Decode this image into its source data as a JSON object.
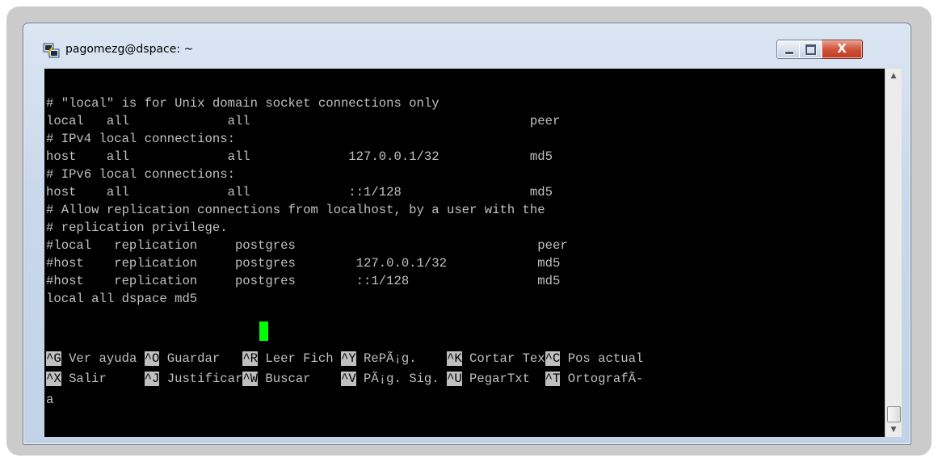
{
  "window": {
    "title": "pagomezg@dspace: ~",
    "minimize_icon": "minimize-icon",
    "maximize_icon": "maximize-icon",
    "close_icon": "close-icon",
    "close_label": "X"
  },
  "terminal": {
    "lines": [
      "# \"local\" is for Unix domain socket connections only",
      "local   all             all                                     peer",
      "# IPv4 local connections:",
      "host    all             all             127.0.0.1/32            md5",
      "# IPv6 local connections:",
      "host    all             all             ::1/128                 md5",
      "# Allow replication connections from localhost, by a user with the",
      "# replication privilege.",
      "#local   replication     postgres                                peer",
      "#host    replication     postgres        127.0.0.1/32            md5",
      "#host    replication     postgres        ::1/128                 md5",
      "local all dspace md5"
    ],
    "shortcuts_row1": [
      {
        "key": "^G",
        "label": " Ver ayuda "
      },
      {
        "key": "^O",
        "label": " Guardar   "
      },
      {
        "key": "^R",
        "label": " Leer Fich "
      },
      {
        "key": "^Y",
        "label": " RePÃ¡g.    "
      },
      {
        "key": "^K",
        "label": " Cortar Tex"
      },
      {
        "key": "^C",
        "label": " Pos actual"
      }
    ],
    "shortcuts_row2": [
      {
        "key": "^X",
        "label": " Salir     "
      },
      {
        "key": "^J",
        "label": " Justificar"
      },
      {
        "key": "^W",
        "label": " Buscar    "
      },
      {
        "key": "^V",
        "label": " PÃ¡g. Sig. "
      },
      {
        "key": "^U",
        "label": " PegarTxt  "
      },
      {
        "key": "^T",
        "label": " OrtografÃ-"
      }
    ],
    "wrap_line": "a",
    "colors": {
      "background": "#000000",
      "text": "#c0c0c0",
      "cursor": "#00ff00"
    }
  }
}
